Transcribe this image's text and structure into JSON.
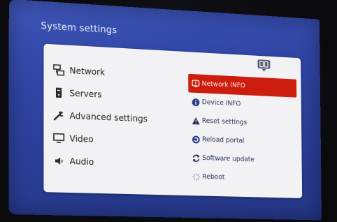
{
  "screen": {
    "title": "System settings"
  },
  "left_menu": {
    "items": [
      {
        "label": "Network",
        "icon": "network-icon"
      },
      {
        "label": "Servers",
        "icon": "server-icon"
      },
      {
        "label": "Advanced settings",
        "icon": "wrench-icon"
      },
      {
        "label": "Video",
        "icon": "monitor-icon"
      },
      {
        "label": "Audio",
        "icon": "speaker-icon"
      }
    ]
  },
  "right_menu": {
    "selected_index": 0,
    "items": [
      {
        "label": "Network INFO",
        "icon": "info-exclamation-icon"
      },
      {
        "label": "Device INFO",
        "icon": "info-icon"
      },
      {
        "label": "Reset settings",
        "icon": "warning-icon"
      },
      {
        "label": "Reload portal",
        "icon": "reload-icon"
      },
      {
        "label": "Software update",
        "icon": "sync-icon"
      },
      {
        "label": "Reboot",
        "icon": "spinner-icon"
      }
    ]
  },
  "colors": {
    "screen_bg": "#2f44a3",
    "panel_bg": "#f2f2f4",
    "selected_bg": "#cc1d0e",
    "icon_blue": "#2a3a8a"
  }
}
